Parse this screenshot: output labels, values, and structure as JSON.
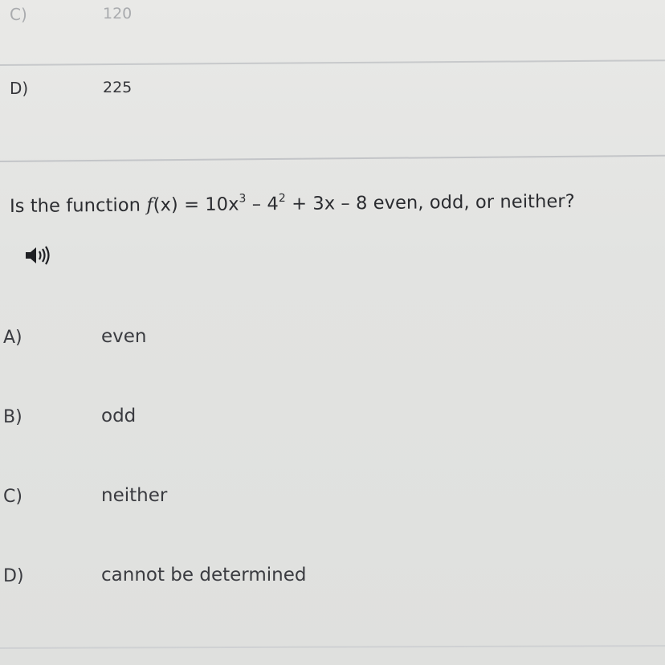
{
  "previous_question": {
    "faint_choice": {
      "letter": "C)",
      "value": "120"
    },
    "last_choice": {
      "letter": "D)",
      "value": "225"
    }
  },
  "question": {
    "prefix": "Is the function ",
    "function_name": "f",
    "expression_start": "(x) = 10x",
    "exp1": "3",
    "expression_mid": " – 4",
    "exp2": "2",
    "expression_end": " + 3x – 8 even, odd, or neither?"
  },
  "audio": {
    "icon": "speaker-icon"
  },
  "choices": [
    {
      "letter": "A)",
      "text": "even"
    },
    {
      "letter": "B)",
      "text": "odd"
    },
    {
      "letter": "C)",
      "text": "neither"
    },
    {
      "letter": "D)",
      "text": "cannot be determined"
    }
  ],
  "colors": {
    "background": "#e4e4e2",
    "text": "#2e2f33",
    "divider": "#c7c9cb"
  }
}
